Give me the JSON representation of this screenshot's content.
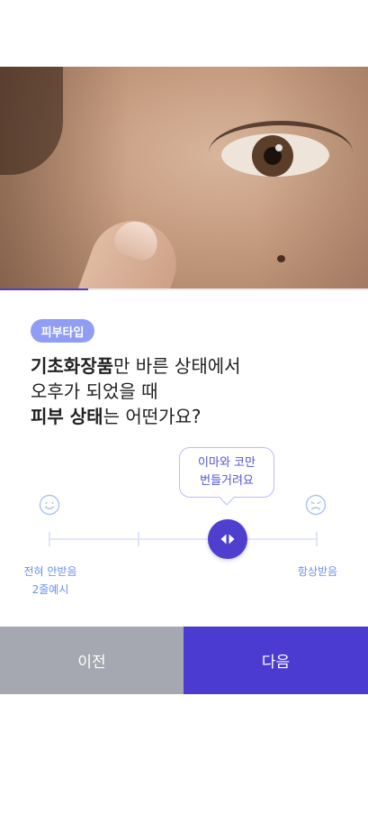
{
  "progress": {
    "fraction": 0.24
  },
  "badge": {
    "label": "피부타입"
  },
  "question": {
    "line1_bold": "기초화장품",
    "line1_rest": "만 바른 상태에서",
    "line2": "오후가 되었을 때",
    "line3_bold": "피부 상태",
    "line3_rest": "는 어떤가요?"
  },
  "slider": {
    "tooltip_line1": "이마와 코만",
    "tooltip_line2": "번들거려요",
    "left_label_line1": "전혀 안받음",
    "left_label_line2": "2줄예시",
    "right_label": "항상받음",
    "left_icon": "smile-icon",
    "right_icon": "frown-icon",
    "thumb_icon": "left-right-arrows-icon",
    "step_count": 4,
    "selected_step": 3
  },
  "buttons": {
    "prev_label": "이전",
    "next_label": "다음"
  },
  "colors": {
    "accent": "#4c3bd0",
    "badge": "#8f9df5",
    "secondary_button": "#a5a8b0",
    "label_blue": "#6c8ff0"
  }
}
